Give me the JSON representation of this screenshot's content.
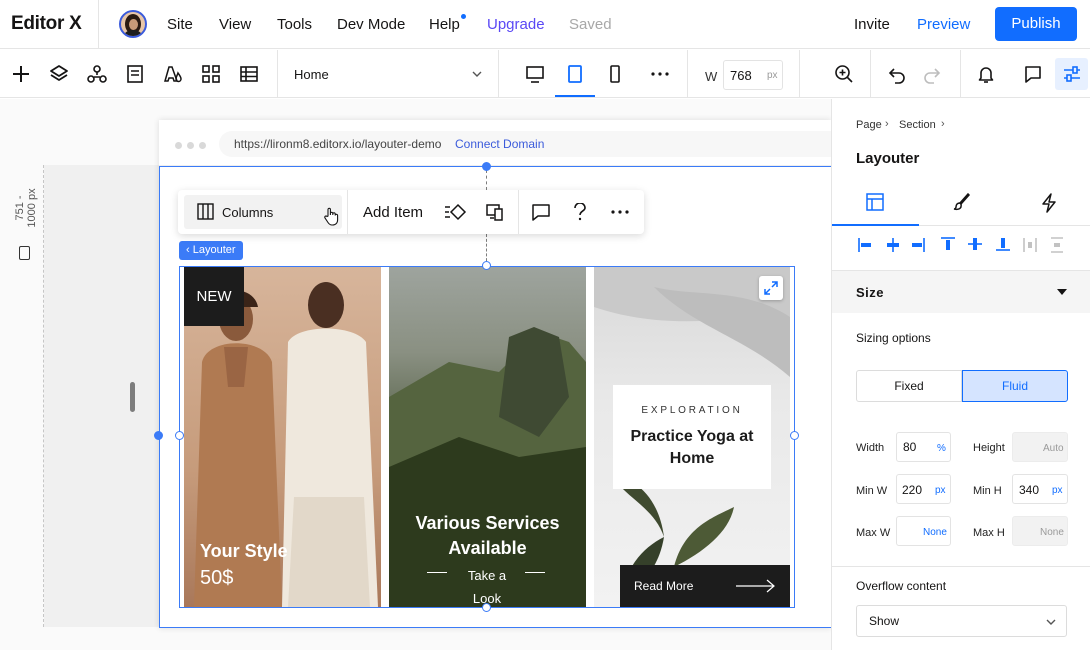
{
  "app": {
    "brand": "Editor X",
    "menu": [
      "Site",
      "View",
      "Tools",
      "Dev Mode",
      "Help"
    ],
    "upgrade": "Upgrade",
    "saved": "Saved",
    "invite": "Invite",
    "preview": "Preview",
    "publish": "Publish"
  },
  "toolbar": {
    "page": "Home",
    "width_label": "W",
    "width_value": "768",
    "width_unit": "px"
  },
  "canvas": {
    "ruler_text": "751 - 1000 px",
    "url": "https://lironm8.editorx.io/layouter-demo",
    "connect_domain": "Connect Domain",
    "float_toolbar": {
      "columns": "Columns",
      "add_item": "Add Item"
    },
    "layouter_tag": "‹ Layouter",
    "cards": {
      "badge": "NEW",
      "style_title": "Your Style",
      "style_price": "50$",
      "services_title": "Various Services Available",
      "take_look": "Take a Look",
      "exploration": "EXPLORATION",
      "yoga_title": "Practice Yoga at Home",
      "read_more": "Read More"
    }
  },
  "panel": {
    "breadcrumb": [
      "Page",
      "Section"
    ],
    "title": "Layouter",
    "size_header": "Size",
    "sizing_options": "Sizing options",
    "fixed": "Fixed",
    "fluid": "Fluid",
    "width_label": "Width",
    "width_value": "80",
    "width_unit": "%",
    "height_label": "Height",
    "height_value": "Auto",
    "min_w_label": "Min W",
    "min_w_value": "220",
    "min_w_unit": "px",
    "min_h_label": "Min H",
    "min_h_value": "340",
    "min_h_unit": "px",
    "max_w_label": "Max W",
    "max_w_value": "None",
    "max_h_label": "Max H",
    "max_h_value": "None",
    "overflow_label": "Overflow content",
    "overflow_value": "Show"
  },
  "colors": {
    "accent": "#116dff",
    "upgrade": "#5a48f5",
    "selection": "#3b7bf7"
  }
}
